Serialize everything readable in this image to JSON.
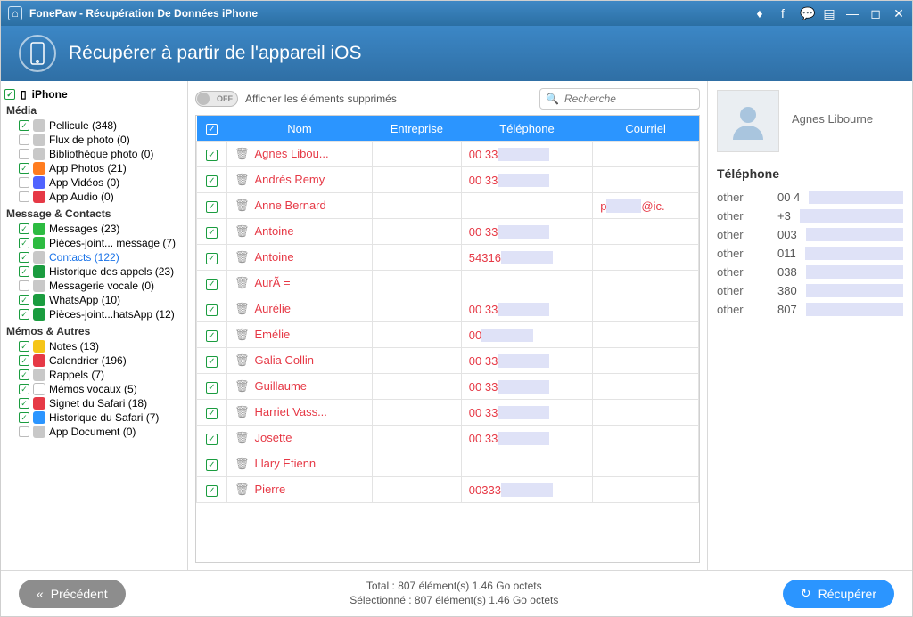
{
  "titlebar": {
    "app_title": "FonePaw - Récupération De Données iPhone"
  },
  "header": {
    "title": "Récupérer à partir de l'appareil iOS"
  },
  "sidebar": {
    "device": "iPhone",
    "sections": {
      "media": {
        "header": "Média",
        "items": [
          {
            "label": "Pellicule",
            "count": 348,
            "checked": true,
            "icon": "gray"
          },
          {
            "label": "Flux de photo",
            "count": 0,
            "checked": false,
            "icon": "gray"
          },
          {
            "label": "Bibliothèque photo",
            "count": 0,
            "checked": false,
            "icon": "gray"
          },
          {
            "label": "App Photos",
            "count": 21,
            "checked": true,
            "icon": "orange"
          },
          {
            "label": "App Vidéos",
            "count": 0,
            "checked": false,
            "icon": "film"
          },
          {
            "label": "App Audio",
            "count": 0,
            "checked": false,
            "icon": "red"
          }
        ]
      },
      "msg": {
        "header": "Message & Contacts",
        "items": [
          {
            "label": "Messages",
            "count": 23,
            "checked": true,
            "icon": "green"
          },
          {
            "label": "Pièces-joint... message",
            "count": 7,
            "checked": true,
            "icon": "green"
          },
          {
            "label": "Contacts",
            "count": 122,
            "checked": true,
            "icon": "gray",
            "selected": true
          },
          {
            "label": "Historique des appels",
            "count": 23,
            "checked": true,
            "icon": "greend"
          },
          {
            "label": "Messagerie vocale",
            "count": 0,
            "checked": false,
            "icon": "gray"
          },
          {
            "label": "WhatsApp",
            "count": 10,
            "checked": true,
            "icon": "greend"
          },
          {
            "label": "Pièces-joint...hatsApp",
            "count": 12,
            "checked": true,
            "icon": "greend"
          }
        ]
      },
      "other": {
        "header": "Mémos & Autres",
        "items": [
          {
            "label": "Notes",
            "count": 13,
            "checked": true,
            "icon": "yel"
          },
          {
            "label": "Calendrier",
            "count": 196,
            "checked": true,
            "icon": "red"
          },
          {
            "label": "Rappels",
            "count": 7,
            "checked": true,
            "icon": "gray"
          },
          {
            "label": "Mémos vocaux",
            "count": 5,
            "checked": true,
            "icon": "wht"
          },
          {
            "label": "Signet du Safari",
            "count": 18,
            "checked": true,
            "icon": "red"
          },
          {
            "label": "Historique du Safari",
            "count": 7,
            "checked": true,
            "icon": "blue"
          },
          {
            "label": "App Document",
            "count": 0,
            "checked": false,
            "icon": "gray"
          }
        ]
      }
    }
  },
  "toolbar": {
    "toggle_text": "OFF",
    "toggle_label": "Afficher les éléments supprimés",
    "search_placeholder": "Recherche"
  },
  "table": {
    "headers": {
      "name": "Nom",
      "company": "Entreprise",
      "phone": "Téléphone",
      "email": "Courriel"
    },
    "rows": [
      {
        "name": "Agnes Libou...",
        "phone": "00 33",
        "email": ""
      },
      {
        "name": "Andrés Remy",
        "phone": "00 33",
        "email": ""
      },
      {
        "name": "Anne Bernard",
        "phone": "",
        "email": "p              @ic."
      },
      {
        "name": "Antoine",
        "phone": "00 33",
        "email": ""
      },
      {
        "name": "Antoine",
        "phone": "54316",
        "email": ""
      },
      {
        "name": "AurÃ =",
        "phone": "",
        "email": ""
      },
      {
        "name": "Aurélie",
        "phone": "00 33",
        "email": ""
      },
      {
        "name": "Emélie",
        "phone": "00",
        "email": ""
      },
      {
        "name": "Galia Collin",
        "phone": "00 33",
        "email": ""
      },
      {
        "name": "Guillaume",
        "phone": "00 33",
        "email": ""
      },
      {
        "name": "Harriet Vass...",
        "phone": "00 33",
        "email": ""
      },
      {
        "name": "Josette",
        "phone": "00 33",
        "email": ""
      },
      {
        "name": "Llary Etienn",
        "phone": "",
        "email": ""
      },
      {
        "name": "Pierre",
        "phone": "00333",
        "email": ""
      }
    ]
  },
  "detail": {
    "name": "Agnes Libourne",
    "section": "Téléphone",
    "phones": [
      {
        "k": "other",
        "v": "00 4"
      },
      {
        "k": "other",
        "v": "+3"
      },
      {
        "k": "other",
        "v": "003"
      },
      {
        "k": "other",
        "v": "011"
      },
      {
        "k": "other",
        "v": "038"
      },
      {
        "k": "other",
        "v": "380"
      },
      {
        "k": "other",
        "v": "807"
      }
    ]
  },
  "footer": {
    "prev": "Précédent",
    "recover": "Récupérer",
    "total": "Total : 807 élément(s) 1.46 Go octets",
    "selected": "Sélectionné : 807 élément(s) 1.46 Go octets"
  }
}
